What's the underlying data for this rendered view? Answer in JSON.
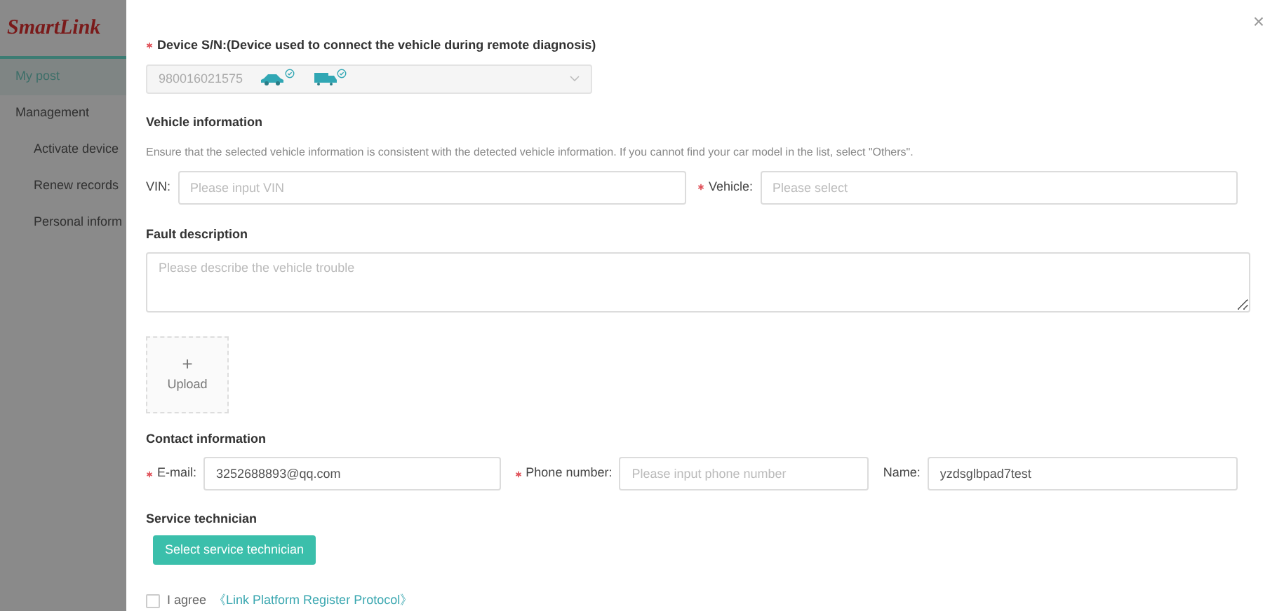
{
  "sidebar": {
    "logo": "SmartLink",
    "items": [
      {
        "label": "My post",
        "selected": true,
        "kind": "top"
      },
      {
        "label": "Management",
        "selected": false,
        "kind": "top"
      },
      {
        "label": "Activate device",
        "selected": false,
        "kind": "sub"
      },
      {
        "label": "Renew records",
        "selected": false,
        "kind": "sub"
      },
      {
        "label": "Personal inform",
        "selected": false,
        "kind": "sub"
      }
    ]
  },
  "dialog": {
    "close": "×",
    "device": {
      "label": "Device S/N:(Device used to connect the vehicle during remote diagnosis)",
      "required": true,
      "value": "980016021575",
      "disabled": true
    },
    "vehicle_info": {
      "heading": "Vehicle information",
      "note": "Ensure that the selected vehicle information is consistent with the detected vehicle information. If you cannot find your car model in the list, select \"Others\".",
      "fields": [
        {
          "label": "VIN:",
          "required": false,
          "placeholder": "Please input VIN"
        },
        {
          "label": "Vehicle:",
          "required": true,
          "placeholder": "Please select"
        }
      ]
    },
    "fault": {
      "heading": "Fault description",
      "placeholder": "Please describe the vehicle trouble"
    },
    "upload": {
      "plus": "+",
      "label": "Upload"
    },
    "contact": {
      "heading": "Contact information",
      "fields": [
        {
          "label": "E-mail:",
          "required": true,
          "value": "3252688893@qq.com"
        },
        {
          "label": "Phone number:",
          "required": true,
          "placeholder": "Please input phone number"
        },
        {
          "label": "Name:",
          "required": false,
          "value": "yzdsglbpad7test"
        }
      ]
    },
    "technician": {
      "heading": "Service technician",
      "button": "Select service technician"
    },
    "agree": {
      "checked": false,
      "text": "I agree",
      "link": "《Link Platform Register Protocol》"
    }
  }
}
